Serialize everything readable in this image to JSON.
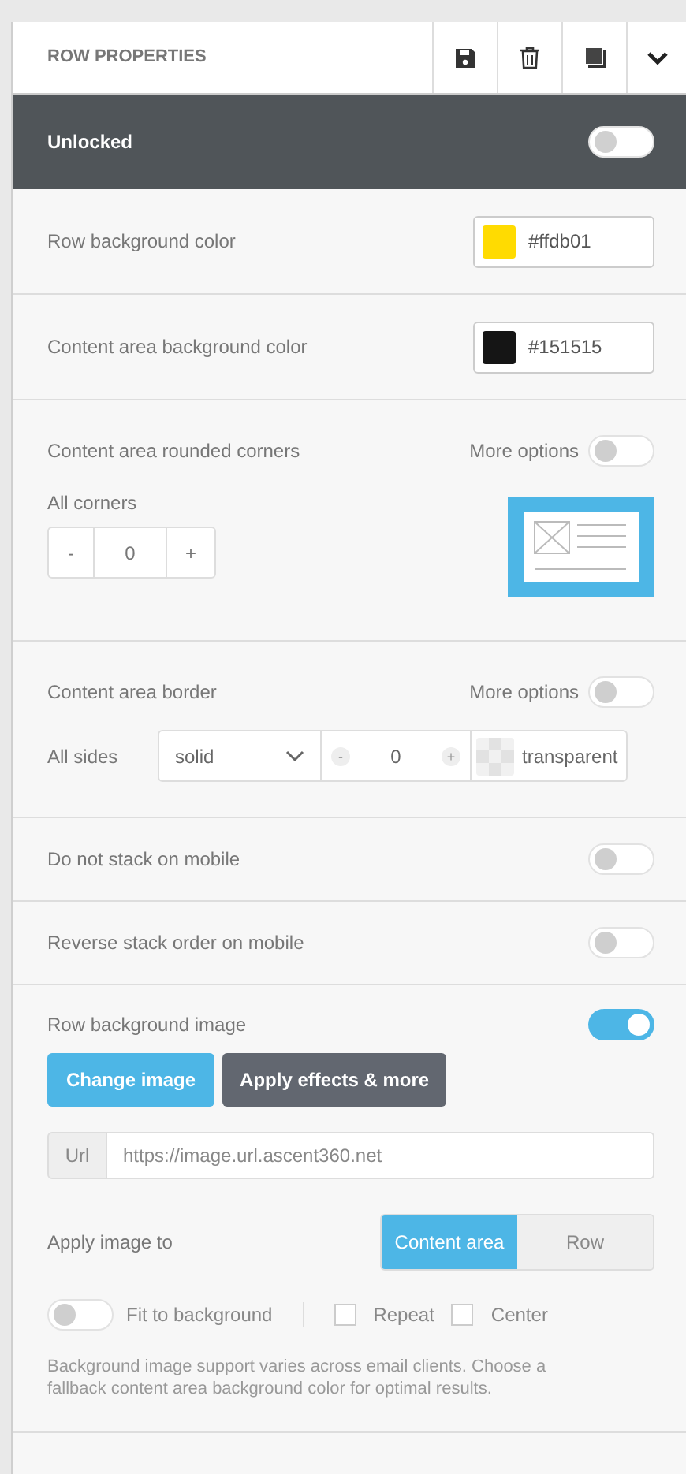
{
  "header": {
    "title": "ROW PROPERTIES"
  },
  "lock_bar": {
    "label": "Unlocked",
    "on": false
  },
  "colors": [
    {
      "label": "Row background color",
      "color": "#ffdb01",
      "value": "#ffdb01"
    },
    {
      "label": "Content area background color",
      "color": "#151515",
      "value": "#151515"
    }
  ],
  "rounded_corners": {
    "label": "Content area rounded corners",
    "more_options_label": "More options",
    "more_options_on": false,
    "sub_label": "All corners",
    "minus": "-",
    "value": "0",
    "plus": "+"
  },
  "border": {
    "label": "Content area border",
    "more_options_label": "More options",
    "more_options_on": false,
    "sub_label": "All sides",
    "style": "solid",
    "minus": "-",
    "value": "0",
    "plus": "+",
    "color_value": "transparent"
  },
  "toggles": [
    {
      "label": "Do not stack on mobile",
      "on": false
    },
    {
      "label": "Reverse stack order on mobile",
      "on": false
    }
  ],
  "background_image": {
    "label": "Row background image",
    "on": true,
    "change_button": "Change image",
    "effects_button": "Apply effects & more",
    "url_label": "Url",
    "url_placeholder": "https://image.url.ascent360.net",
    "apply_label": "Apply image to",
    "segments": [
      {
        "label": "Content area",
        "selected": true
      },
      {
        "label": "Row",
        "selected": false
      }
    ],
    "fit_label": "Fit to background",
    "fit_on": false,
    "checkboxes": [
      {
        "label": "Repeat",
        "checked": false
      },
      {
        "label": "Center",
        "checked": false
      }
    ],
    "note": "Background image support varies across email clients. Choose a fallback content area background color for optimal results."
  }
}
